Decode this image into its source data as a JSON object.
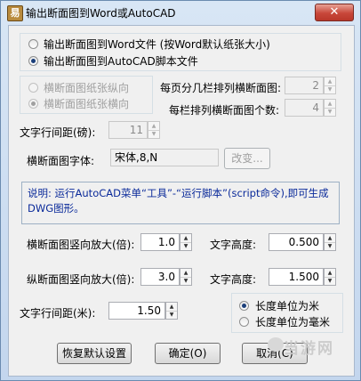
{
  "window": {
    "title": "输出断面图到Word或AutoCAD",
    "app_icon_glyph": "易",
    "close_glyph": "✕"
  },
  "output_mode": {
    "options": [
      {
        "label": "输出断面图到Word文件 (按Word默认纸张大小)",
        "selected": false
      },
      {
        "label": "输出断面图到AutoCAD脚本文件",
        "selected": true
      }
    ]
  },
  "orientation": {
    "options": [
      {
        "label": "横断面图纸张纵向",
        "selected": false,
        "enabled": false
      },
      {
        "label": "横断面图纸张横向",
        "selected": true,
        "enabled": false
      }
    ]
  },
  "columns_per_page": {
    "label": "每页分几栏排列横断面图:",
    "value": "2",
    "enabled": false
  },
  "items_per_column": {
    "label": "每栏排列横断面图个数:",
    "value": "4",
    "enabled": false
  },
  "line_spacing_pound": {
    "label": "文字行间距(磅):",
    "value": "11",
    "enabled": false
  },
  "font": {
    "label": "横断面图字体:",
    "value": "宋体,8,N",
    "change_button": "改变..."
  },
  "note": {
    "text": "说明: 运行AutoCAD菜单“工具”-“运行脚本”(script命令),即可生成DWG图形。"
  },
  "cross_vscale": {
    "label": "横断面图竖向放大(倍):",
    "value": "1.0"
  },
  "cross_text_height": {
    "label": "文字高度:",
    "value": "0.500"
  },
  "long_vscale": {
    "label": "纵断面图竖向放大(倍):",
    "value": "3.0"
  },
  "long_text_height": {
    "label": "文字高度:",
    "value": "1.500"
  },
  "line_spacing_m": {
    "label": "文字行间距(米):",
    "value": "1.50"
  },
  "length_unit": {
    "options": [
      {
        "label": "长度单位为米",
        "selected": true
      },
      {
        "label": "长度单位为毫米",
        "selected": false
      }
    ]
  },
  "buttons": {
    "restore_defaults": "恢复默认设置",
    "ok": "确定(O)",
    "cancel": "取消(C)"
  },
  "watermark": {
    "text": "当游网"
  },
  "colors": {
    "note_text": "#0a2a9a",
    "title_bar": "#c3d6ee",
    "close_button": "#c8473a"
  }
}
